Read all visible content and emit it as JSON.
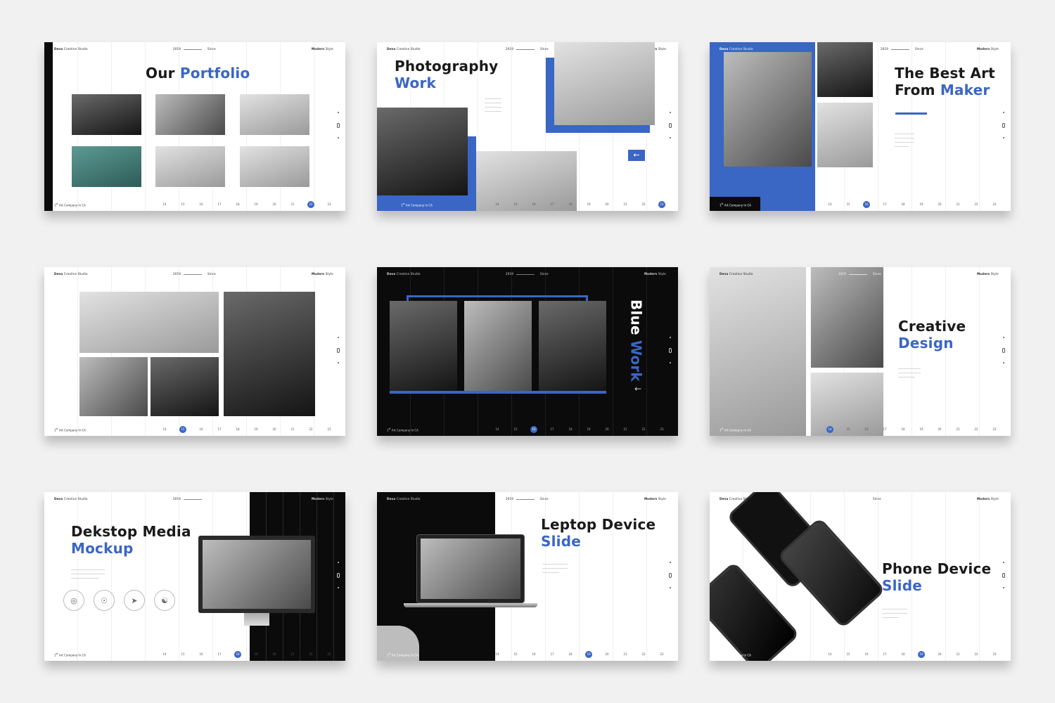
{
  "header": {
    "studio": "Creative Studio",
    "studio_bold": "Dena",
    "year": "2019",
    "since": "Since",
    "style_bold": "Modern",
    "style": "Style"
  },
  "footer": {
    "company": "Art Company In CA"
  },
  "slides": [
    {
      "title_1": "Our",
      "title_2": "Portfolio",
      "pages": [
        "14",
        "15",
        "16",
        "17",
        "18",
        "19",
        "20",
        "21",
        "22",
        "23"
      ],
      "active": 8
    },
    {
      "title_1": "Photography",
      "title_2": "Work",
      "pages": [
        "14",
        "15",
        "16",
        "17",
        "18",
        "19",
        "20",
        "21",
        "22",
        "23"
      ],
      "active": 9
    },
    {
      "title_1": "The Best Art",
      "title_2a": "From",
      "title_2b": "Maker",
      "pages": [
        "14",
        "15",
        "16",
        "17",
        "18",
        "19",
        "20",
        "21",
        "22",
        "23"
      ],
      "active": 2
    },
    {
      "pages": [
        "14",
        "15",
        "16",
        "17",
        "18",
        "19",
        "20",
        "21",
        "22",
        "23"
      ],
      "active": 1
    },
    {
      "title_1": "Blue",
      "title_2": "Work",
      "pages": [
        "14",
        "15",
        "16",
        "17",
        "18",
        "19",
        "20",
        "21",
        "22",
        "23"
      ],
      "active": 2
    },
    {
      "title_1": "Creative",
      "title_2": "Design",
      "pages": [
        "14",
        "15",
        "16",
        "17",
        "18",
        "19",
        "20",
        "21",
        "22",
        "23"
      ],
      "active": 0
    },
    {
      "title_1": "Dekstop Media",
      "title_2": "Mockup",
      "pages": [
        "14",
        "15",
        "16",
        "17",
        "18",
        "19",
        "20",
        "21",
        "22",
        "23"
      ],
      "active": 4
    },
    {
      "title_1": "Leptop Device",
      "title_2": "Slide",
      "pages": [
        "14",
        "15",
        "16",
        "17",
        "18",
        "19",
        "20",
        "21",
        "22",
        "23"
      ],
      "active": 5
    },
    {
      "title_1": "Phone Device",
      "title_2": "Slide",
      "pages": [
        "14",
        "15",
        "16",
        "17",
        "18",
        "19",
        "20",
        "21",
        "22",
        "23"
      ],
      "active": 5
    }
  ],
  "colors": {
    "accent": "#3a66c4",
    "dark": "#0b0b0b"
  },
  "icons": [
    "target-icon",
    "shield-icon",
    "paper-plane-icon",
    "handshake-icon"
  ]
}
